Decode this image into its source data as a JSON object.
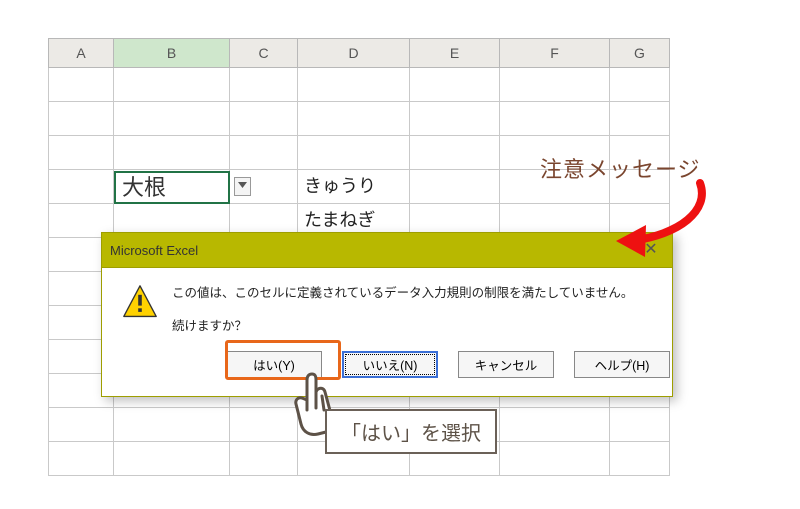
{
  "columns": {
    "A": "A",
    "B": "B",
    "C": "C",
    "D": "D",
    "E": "E",
    "F": "F",
    "G": "G"
  },
  "cells": {
    "B4": "大根",
    "D4": "きゅうり",
    "D5": "たまねぎ"
  },
  "dialog": {
    "title": "Microsoft Excel",
    "message": "この値は、このセルに定義されているデータ入力規則の制限を満たしていません。",
    "prompt": "続けますか？",
    "buttons": {
      "yes": "はい(Y)",
      "no": "いいえ(N)",
      "cancel": "キャンセル",
      "help": "ヘルプ(H)"
    },
    "close": "✕"
  },
  "annotations": {
    "warning_label": "注意メッセージ",
    "choose_yes": "「はい」を選択"
  }
}
